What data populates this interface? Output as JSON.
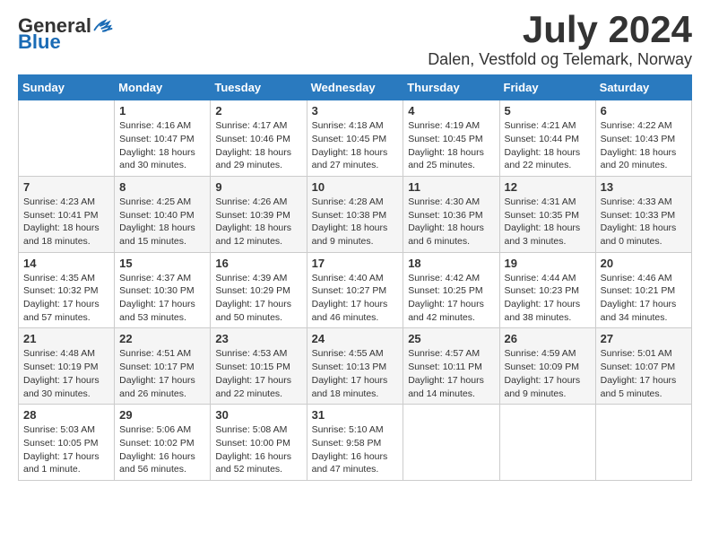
{
  "logo": {
    "general": "General",
    "blue": "Blue"
  },
  "title": "July 2024",
  "location": "Dalen, Vestfold og Telemark, Norway",
  "days_of_week": [
    "Sunday",
    "Monday",
    "Tuesday",
    "Wednesday",
    "Thursday",
    "Friday",
    "Saturday"
  ],
  "weeks": [
    [
      {
        "day": "",
        "info": ""
      },
      {
        "day": "1",
        "info": "Sunrise: 4:16 AM\nSunset: 10:47 PM\nDaylight: 18 hours\nand 30 minutes."
      },
      {
        "day": "2",
        "info": "Sunrise: 4:17 AM\nSunset: 10:46 PM\nDaylight: 18 hours\nand 29 minutes."
      },
      {
        "day": "3",
        "info": "Sunrise: 4:18 AM\nSunset: 10:45 PM\nDaylight: 18 hours\nand 27 minutes."
      },
      {
        "day": "4",
        "info": "Sunrise: 4:19 AM\nSunset: 10:45 PM\nDaylight: 18 hours\nand 25 minutes."
      },
      {
        "day": "5",
        "info": "Sunrise: 4:21 AM\nSunset: 10:44 PM\nDaylight: 18 hours\nand 22 minutes."
      },
      {
        "day": "6",
        "info": "Sunrise: 4:22 AM\nSunset: 10:43 PM\nDaylight: 18 hours\nand 20 minutes."
      }
    ],
    [
      {
        "day": "7",
        "info": "Sunrise: 4:23 AM\nSunset: 10:41 PM\nDaylight: 18 hours\nand 18 minutes."
      },
      {
        "day": "8",
        "info": "Sunrise: 4:25 AM\nSunset: 10:40 PM\nDaylight: 18 hours\nand 15 minutes."
      },
      {
        "day": "9",
        "info": "Sunrise: 4:26 AM\nSunset: 10:39 PM\nDaylight: 18 hours\nand 12 minutes."
      },
      {
        "day": "10",
        "info": "Sunrise: 4:28 AM\nSunset: 10:38 PM\nDaylight: 18 hours\nand 9 minutes."
      },
      {
        "day": "11",
        "info": "Sunrise: 4:30 AM\nSunset: 10:36 PM\nDaylight: 18 hours\nand 6 minutes."
      },
      {
        "day": "12",
        "info": "Sunrise: 4:31 AM\nSunset: 10:35 PM\nDaylight: 18 hours\nand 3 minutes."
      },
      {
        "day": "13",
        "info": "Sunrise: 4:33 AM\nSunset: 10:33 PM\nDaylight: 18 hours\nand 0 minutes."
      }
    ],
    [
      {
        "day": "14",
        "info": "Sunrise: 4:35 AM\nSunset: 10:32 PM\nDaylight: 17 hours\nand 57 minutes."
      },
      {
        "day": "15",
        "info": "Sunrise: 4:37 AM\nSunset: 10:30 PM\nDaylight: 17 hours\nand 53 minutes."
      },
      {
        "day": "16",
        "info": "Sunrise: 4:39 AM\nSunset: 10:29 PM\nDaylight: 17 hours\nand 50 minutes."
      },
      {
        "day": "17",
        "info": "Sunrise: 4:40 AM\nSunset: 10:27 PM\nDaylight: 17 hours\nand 46 minutes."
      },
      {
        "day": "18",
        "info": "Sunrise: 4:42 AM\nSunset: 10:25 PM\nDaylight: 17 hours\nand 42 minutes."
      },
      {
        "day": "19",
        "info": "Sunrise: 4:44 AM\nSunset: 10:23 PM\nDaylight: 17 hours\nand 38 minutes."
      },
      {
        "day": "20",
        "info": "Sunrise: 4:46 AM\nSunset: 10:21 PM\nDaylight: 17 hours\nand 34 minutes."
      }
    ],
    [
      {
        "day": "21",
        "info": "Sunrise: 4:48 AM\nSunset: 10:19 PM\nDaylight: 17 hours\nand 30 minutes."
      },
      {
        "day": "22",
        "info": "Sunrise: 4:51 AM\nSunset: 10:17 PM\nDaylight: 17 hours\nand 26 minutes."
      },
      {
        "day": "23",
        "info": "Sunrise: 4:53 AM\nSunset: 10:15 PM\nDaylight: 17 hours\nand 22 minutes."
      },
      {
        "day": "24",
        "info": "Sunrise: 4:55 AM\nSunset: 10:13 PM\nDaylight: 17 hours\nand 18 minutes."
      },
      {
        "day": "25",
        "info": "Sunrise: 4:57 AM\nSunset: 10:11 PM\nDaylight: 17 hours\nand 14 minutes."
      },
      {
        "day": "26",
        "info": "Sunrise: 4:59 AM\nSunset: 10:09 PM\nDaylight: 17 hours\nand 9 minutes."
      },
      {
        "day": "27",
        "info": "Sunrise: 5:01 AM\nSunset: 10:07 PM\nDaylight: 17 hours\nand 5 minutes."
      }
    ],
    [
      {
        "day": "28",
        "info": "Sunrise: 5:03 AM\nSunset: 10:05 PM\nDaylight: 17 hours\nand 1 minute."
      },
      {
        "day": "29",
        "info": "Sunrise: 5:06 AM\nSunset: 10:02 PM\nDaylight: 16 hours\nand 56 minutes."
      },
      {
        "day": "30",
        "info": "Sunrise: 5:08 AM\nSunset: 10:00 PM\nDaylight: 16 hours\nand 52 minutes."
      },
      {
        "day": "31",
        "info": "Sunrise: 5:10 AM\nSunset: 9:58 PM\nDaylight: 16 hours\nand 47 minutes."
      },
      {
        "day": "",
        "info": ""
      },
      {
        "day": "",
        "info": ""
      },
      {
        "day": "",
        "info": ""
      }
    ]
  ]
}
